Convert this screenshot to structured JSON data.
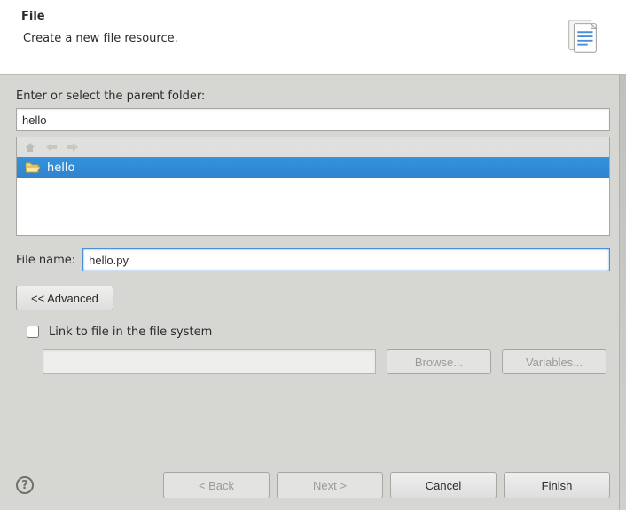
{
  "banner": {
    "title": "File",
    "subtitle": "Create a new file resource."
  },
  "parent_folder_label": "Enter or select the parent folder:",
  "parent_folder_value": "hello",
  "tree": {
    "items": [
      {
        "label": "hello",
        "selected": true
      }
    ]
  },
  "file_name_label": "File name:",
  "file_name_value": "hello.py",
  "advanced_button": "<< Advanced",
  "link_checkbox_label": "Link to file in the file system",
  "link_checked": false,
  "link_path_value": "",
  "browse_button": "Browse...",
  "variables_button": "Variables...",
  "footer": {
    "back": "< Back",
    "next": "Next >",
    "cancel": "Cancel",
    "finish": "Finish"
  }
}
